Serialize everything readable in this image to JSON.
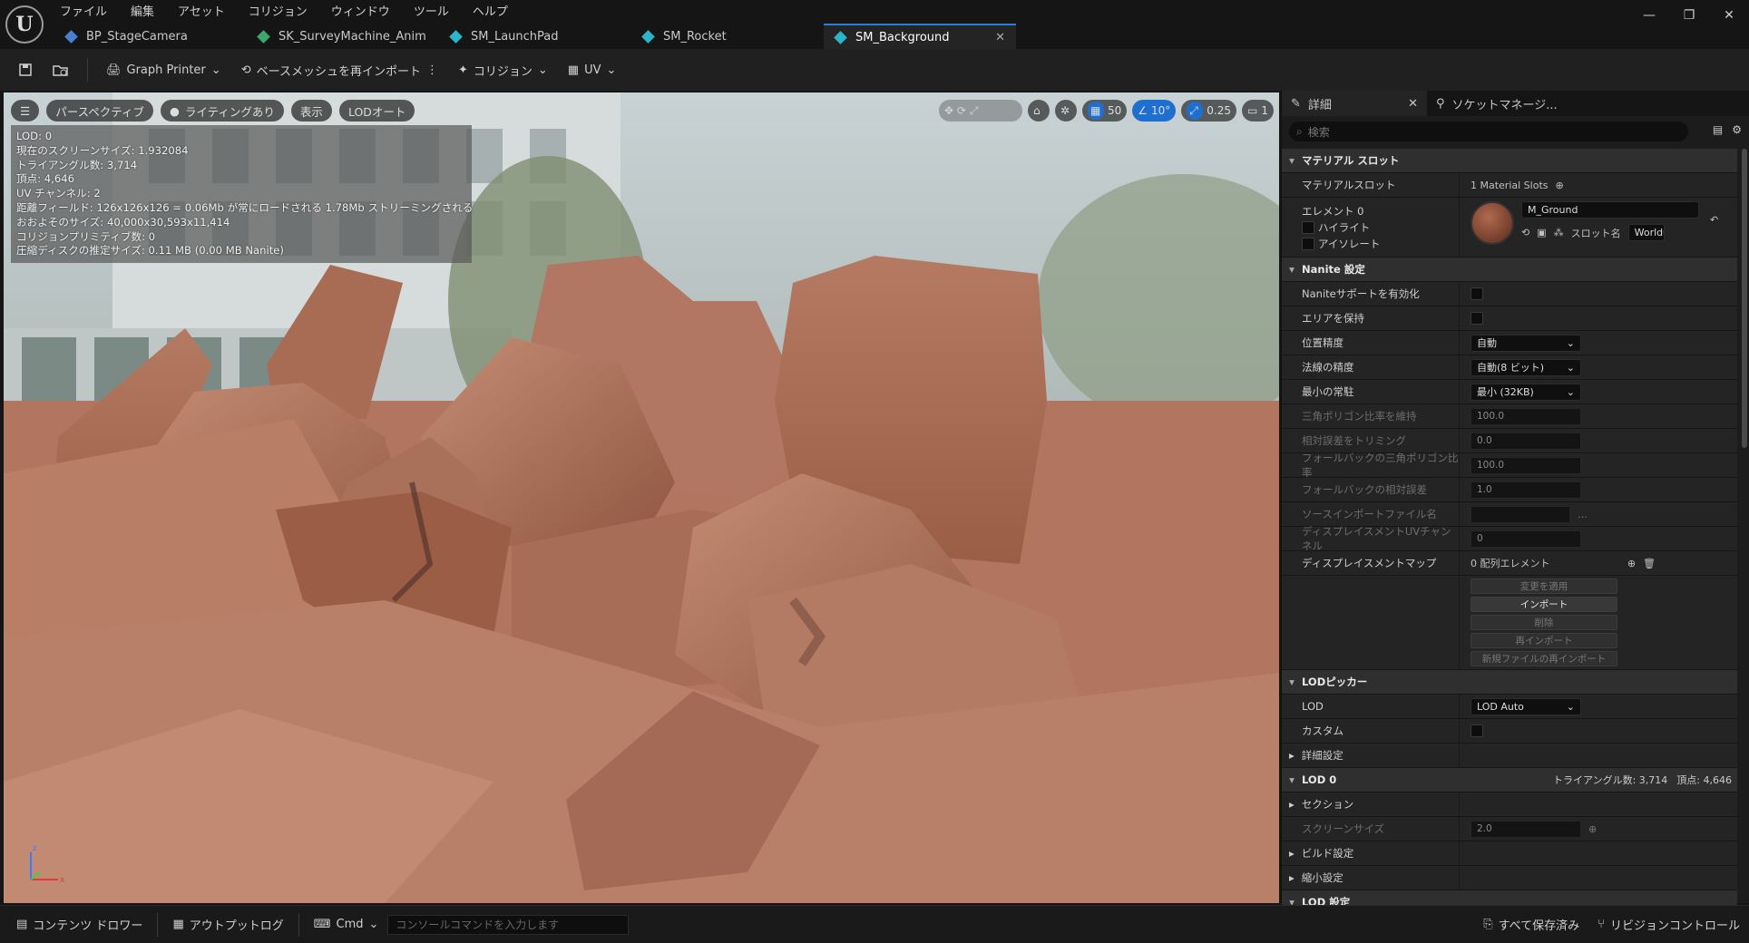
{
  "menu": [
    "ファイル",
    "編集",
    "アセット",
    "コリジョン",
    "ウィンドウ",
    "ツール",
    "ヘルプ"
  ],
  "tabs": [
    {
      "label": "BP_StageCamera",
      "icon": "blueprint-icon"
    },
    {
      "label": "SK_SurveyMachine_Anim",
      "icon": "animation-icon"
    },
    {
      "label": "SM_LaunchPad",
      "icon": "static-mesh-icon"
    },
    {
      "label": "SM_Rocket",
      "icon": "static-mesh-icon"
    },
    {
      "label": "SM_Background",
      "icon": "static-mesh-icon",
      "active": true
    }
  ],
  "toolbar": {
    "graph_printer": "Graph Printer",
    "reimport": "ベースメッシュを再インポート",
    "collision": "コリジョン",
    "uv": "UV"
  },
  "viewport": {
    "perspective": "パースペクティブ",
    "lighting": "ライティングあり",
    "show": "表示",
    "lod": "LODオート",
    "grid_value": "50",
    "angle_value": "10°",
    "scale_value": "0.25",
    "camera_speed": "1",
    "stats": [
      "LOD: 0",
      "現在のスクリーンサイズ: 1.932084",
      "トライアングル数: 3,714",
      "頂点: 4,646",
      "UV チャンネル: 2",
      "距離フィールド: 126x126x126 = 0.06Mb が常にロードされる 1.78Mb ストリーミングされる",
      "おおよそのサイズ: 40,000x30,593x11,414",
      "コリジョンプリミティブ数: 0",
      "圧縮ディスクの推定サイズ: 0.11 MB (0.00 MB Nanite)"
    ]
  },
  "details": {
    "tab_details": "詳細",
    "tab_socket": "ソケットマネージ...",
    "search_placeholder": "検索",
    "material_category": "マテリアル スロット",
    "material_slots_label": "マテリアルスロット",
    "material_slots_value": "1 Material Slots",
    "element0": "エレメント 0",
    "highlight": "ハイライト",
    "isolate": "アイソレート",
    "material_name": "M_Ground",
    "slot_name_label": "スロット名",
    "slot_name_value": "WorldG",
    "nanite_category": "Nanite 設定",
    "nanite_rows": [
      {
        "k": "Naniteサポートを有効化",
        "type": "chk"
      },
      {
        "k": "エリアを保持",
        "type": "chk"
      },
      {
        "k": "位置精度",
        "type": "dd",
        "v": "自動"
      },
      {
        "k": "法線の精度",
        "type": "dd",
        "v": "自動(8 ビット)"
      },
      {
        "k": "最小の常駐",
        "type": "dd",
        "v": "最小 (32KB)"
      },
      {
        "k": "三角ポリゴン比率を維持",
        "type": "num",
        "v": "100.0",
        "dim": true
      },
      {
        "k": "相対誤差をトリミング",
        "type": "num",
        "v": "0.0",
        "dim": true
      },
      {
        "k": "フォールバックの三角ポリゴン比率",
        "type": "num",
        "v": "100.0",
        "dim": true
      },
      {
        "k": "フォールバックの相対誤差",
        "type": "num",
        "v": "1.0",
        "dim": true
      },
      {
        "k": "ソースインポートファイル名",
        "type": "file",
        "v": "",
        "dim": true
      },
      {
        "k": "ディスプレイスメントUVチャンネル",
        "type": "num",
        "v": "0",
        "dim": true
      }
    ],
    "displacement_map": "ディスプレイスメントマップ",
    "displacement_value": "0 配列エレメント",
    "buttons": [
      "変更を適用",
      "インポート",
      "削除",
      "再インポート",
      "新規ファイルの再インポート"
    ],
    "lod_picker_category": "LODピッカー",
    "lod_label": "LOD",
    "lod_value": "LOD Auto",
    "custom_label": "カスタム",
    "advanced": "詳細設定",
    "lod0_category": "LOD 0",
    "lod0_tris": "トライアングル数: 3,714",
    "lod0_verts": "頂点: 4,646",
    "sections": "セクション",
    "screen_size": "スクリーンサイズ",
    "screen_size_value": "2.0",
    "build_settings": "ビルド設定",
    "reduction_settings": "縮小設定",
    "lod_settings": "LOD 設定"
  },
  "status": {
    "content_drawer": "コンテンツ ドロワー",
    "output_log": "アウトプットログ",
    "cmd": "Cmd",
    "console_placeholder": "コンソールコマンドを入力します",
    "save_all": "すべて保存済み",
    "revision": "リビジョンコントロール"
  }
}
